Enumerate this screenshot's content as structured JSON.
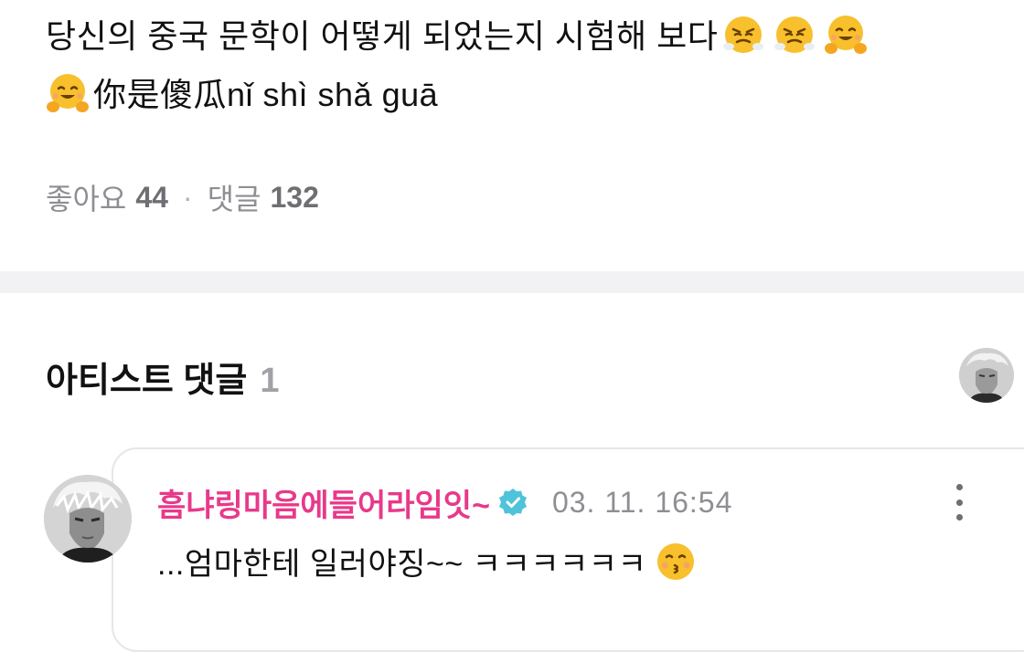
{
  "post": {
    "text_line1": "당신의 중국 문학이 어떻게 되었는지 시험해 보다",
    "text_line2": "你是傻瓜nǐ shì shǎ guā",
    "emojis_line1": [
      "huffing-face-emoji",
      "huffing-face-emoji",
      "hugging-face-emoji"
    ],
    "emoji_line2": "hugging-face-emoji"
  },
  "stats": {
    "likes_label": "좋아요",
    "likes_count": "44",
    "separator": "·",
    "comments_label": "댓글",
    "comments_count": "132"
  },
  "artist_comments": {
    "title": "아티스트 댓글",
    "count": "1"
  },
  "comment": {
    "author": "흠냐링마음에들어라임잇~",
    "timestamp": "03. 11. 16:54",
    "text": "...엄마한테 일러야징~~ ㅋㅋㅋㅋㅋㅋ",
    "emoji": "kissing-face-emoji",
    "author_color": "#e8398a",
    "verified_color": "#4fc3d9"
  }
}
